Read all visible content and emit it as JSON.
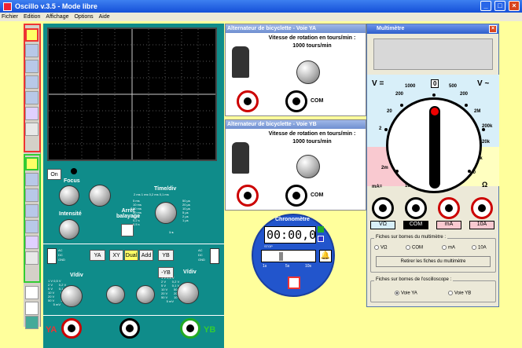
{
  "window": {
    "title": "Oscillo v.3.5 - Mode libre",
    "min": "_",
    "max": "□",
    "close": "×"
  },
  "menu": [
    "Fichier",
    "Edition",
    "Affichage",
    "Options",
    "Aide"
  ],
  "oscillo": {
    "on_label": "On",
    "focus": "Focus",
    "intensite": "Intensité",
    "timediv": "Time/div",
    "arret": "Arrêt balayage",
    "ya": "YA",
    "xy": "XY",
    "dual": "Dual",
    "add": "Add",
    "yb": "YB",
    "minus_yb": "-YB",
    "vdiv_a": "V/div",
    "vdiv_b": "V/div",
    "ac": "AC",
    "dc": "DC",
    "gnd": "GND",
    "ya_label": "YA",
    "yb_label": "YB",
    "time_scale": [
      "2 ms",
      "1 ms",
      "5 ms",
      "10 ms",
      "20 ms",
      "50 ms",
      "0,1 s",
      "0,2 s",
      "0,5 s",
      "1 s",
      "0,2 ms",
      "0,1 ms",
      "50 µs",
      "20 µs",
      "10 µs",
      "5 µs",
      "2 µs",
      "1 µs"
    ],
    "v_scale_a": [
      "1 V",
      "0,5 V",
      "2 V",
      "5 V",
      "10 V",
      "20 V",
      "50 V",
      "0,2 V",
      "0,1 V",
      "50 mV",
      "20 mV",
      "10 mV",
      "5 mV"
    ],
    "v_scale_b": [
      "1 V",
      "0,5 V",
      "2 V",
      "5 V",
      "10 V",
      "20 V",
      "50 V",
      "0,2 V",
      "0,1 V",
      "50 mV",
      "20 mV",
      "10 mV",
      "5 mV"
    ]
  },
  "alt_ya": {
    "title": "Alternateur de bicyclette - Voie YA",
    "vitesse": "Vitesse de rotation en tours/min :",
    "value": "1000 tours/min",
    "com": "COM"
  },
  "alt_yb": {
    "title": "Alternateur de bicyclette - Voie YB",
    "vitesse": "Vitesse de rotation en tours/min :",
    "value": "1000 tours/min",
    "com": "COM"
  },
  "chrono": {
    "title": "Chronomètre",
    "time": "00:00,0",
    "stop": "STOP",
    "t1": "1s",
    "t5": "5s",
    "t10": "10s"
  },
  "multimetre": {
    "title": "Multimètre",
    "v_dc": "V =",
    "v_ac": "V ~",
    "ma_eq": "mA=",
    "omega": "Ω",
    "dial_labels": [
      "1000",
      "0",
      "500",
      "200",
      "200",
      "20",
      "2M",
      "2",
      "200k",
      "20k",
      "2k",
      "2m",
      "200",
      "20m",
      "10A",
      "200m"
    ],
    "jacks": [
      "VΩ",
      "COM",
      "mA",
      "10A"
    ],
    "fiches_title": "Fiches sur bornes du multimètre :",
    "fiches_opts": [
      "VΩ",
      "COM",
      "mA",
      "10A"
    ],
    "retirer": "Retirer les fiches du multimètre",
    "osc_title": "Fiches sur bornes de l'oscilloscope :",
    "osc_opts": [
      "Voie YA",
      "Voie YB"
    ]
  },
  "colors": {
    "accent": "#2e5fcc",
    "panel_teal": "#0f8c8a",
    "workspace": "#ffff9c"
  }
}
